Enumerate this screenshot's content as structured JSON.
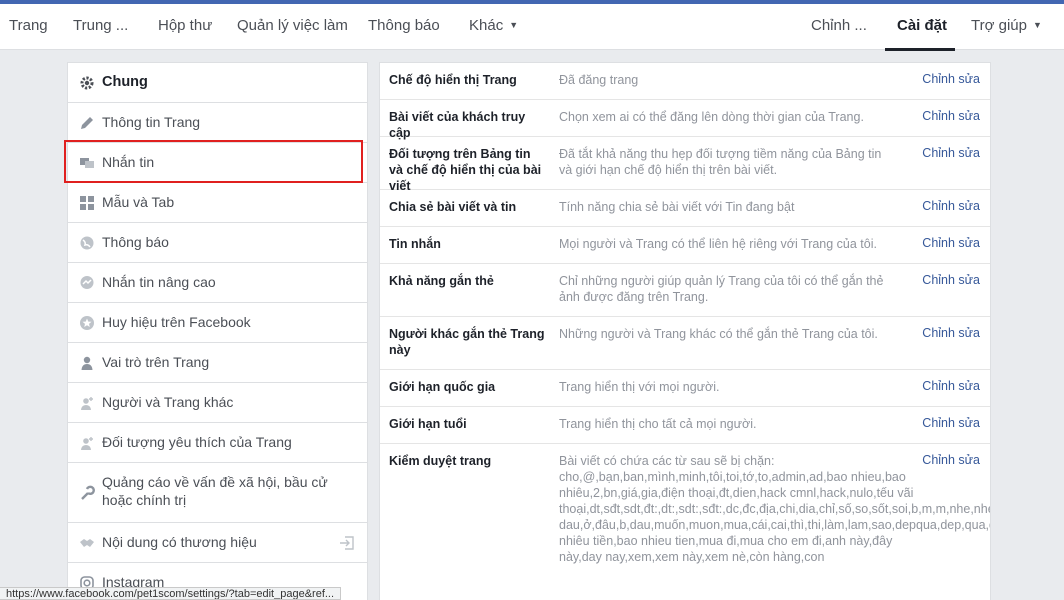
{
  "topnav": {
    "items": [
      "Trang",
      "Trung ...",
      "Hộp thư",
      "Quản lý việc làm",
      "Thông báo",
      "Khác"
    ],
    "right_items": [
      "Chỉnh ...",
      "Cài đặt",
      "Trợ giúp"
    ]
  },
  "sidebar": {
    "items": [
      {
        "label": "Chung",
        "icon": "gear-icon"
      },
      {
        "label": "Thông tin Trang",
        "icon": "pencil-icon"
      },
      {
        "label": "Nhắn tin",
        "icon": "chat-icon"
      },
      {
        "label": "Mẫu và Tab",
        "icon": "grid-icon"
      },
      {
        "label": "Thông báo",
        "icon": "globe-icon"
      },
      {
        "label": "Nhắn tin nâng cao",
        "icon": "messenger-icon"
      },
      {
        "label": "Huy hiệu trên Facebook",
        "icon": "star-badge-icon"
      },
      {
        "label": "Vai trò trên Trang",
        "icon": "person-icon"
      },
      {
        "label": "Người và Trang khác",
        "icon": "person-plus-icon"
      },
      {
        "label": "Đối tượng yêu thích của Trang",
        "icon": "person-plus-icon"
      },
      {
        "label": "Quảng cáo về vấn đề xã hội, bầu cử hoặc chính trị",
        "icon": "wrench-icon"
      },
      {
        "label": "Nội dung có thương hiệu",
        "icon": "handshake-icon"
      },
      {
        "label": "Instagram",
        "icon": "instagram-icon"
      }
    ]
  },
  "settings": {
    "edit_label": "Chỉnh sửa",
    "rows": [
      {
        "label": "Chế độ hiển thị Trang",
        "desc": "Đã đăng trang"
      },
      {
        "label": "Bài viết của khách truy cập",
        "desc": "Chọn xem ai có thể đăng lên dòng thời gian của Trang."
      },
      {
        "label": "Đối tượng trên Bảng tin và chế độ hiển thị của bài viết",
        "desc": "Đã tắt khả năng thu hẹp đối tượng tiềm năng của Bảng tin và giới hạn chế độ hiển thị trên bài viết."
      },
      {
        "label": "Chia sẻ bài viết và tin",
        "desc": "Tính năng chia sẻ bài viết với Tin đang bật"
      },
      {
        "label": "Tin nhắn",
        "desc": "Mọi người và Trang có thể liên hệ riêng với Trang của tôi."
      },
      {
        "label": "Khả năng gắn thẻ",
        "desc": "Chỉ những người giúp quản lý Trang của tôi có thể gắn thẻ ảnh được đăng trên Trang."
      },
      {
        "label": "Người khác gắn thẻ Trang này",
        "desc": "Những người và Trang khác có thể gắn thẻ Trang của tôi."
      },
      {
        "label": "Giới hạn quốc gia",
        "desc": "Trang hiển thị với mọi người."
      },
      {
        "label": "Giới hạn tuổi",
        "desc": "Trang hiển thị cho tất cả mọi người."
      },
      {
        "label": "Kiểm duyệt trang",
        "desc": "Bài viết có chứa các từ sau sẽ bị chặn: cho,@,bạn,ban,mình,minh,tôi,toi,tớ,to,admin,ad,bao nhieu,bao nhiêu,2,bn,giá,gia,điện thoại,đt,dien,hack cmnl,hack,nulo,tếu vãi thoại,dt,sđt,sdt,đt:,dt:,sdt:,sđt:,dc,đc,địa,chi,dia,chỉ,số,so,sốt,soi,b,m,m,nhe,nhé,nha,nhá,dep,đẹp,đặt,dat,chi,chi,c0,cò,chợ,chơ,chùa,chua,nam,nu,nữ,và,va,vs,o dau,ở,đâu,b,dau,muốn,muon,mua,cái,cai,thì,thi,làm,lam,sao,depqua,dep,qua,đẹp,quá,màu,mau,chất,chat,đm,dm,đcm,dcm,vl,vcl,vd,lta,đảo,lua,dao,1,à,1,b,c,d,e,f,g,h,i,j,k,i,7,0,0,0,0,q,r,s,u,v,w,y,z,giá,gia,bao nhiêu tiền,bao nhieu tien,mua đi,mua cho em đi,anh này,đây này,day nay,xem,xem này,xem nè,còn hàng,con"
      }
    ]
  },
  "statusbar": {
    "url": "https://www.facebook.com/pet1scom/settings/?tab=edit_page&ref..."
  }
}
